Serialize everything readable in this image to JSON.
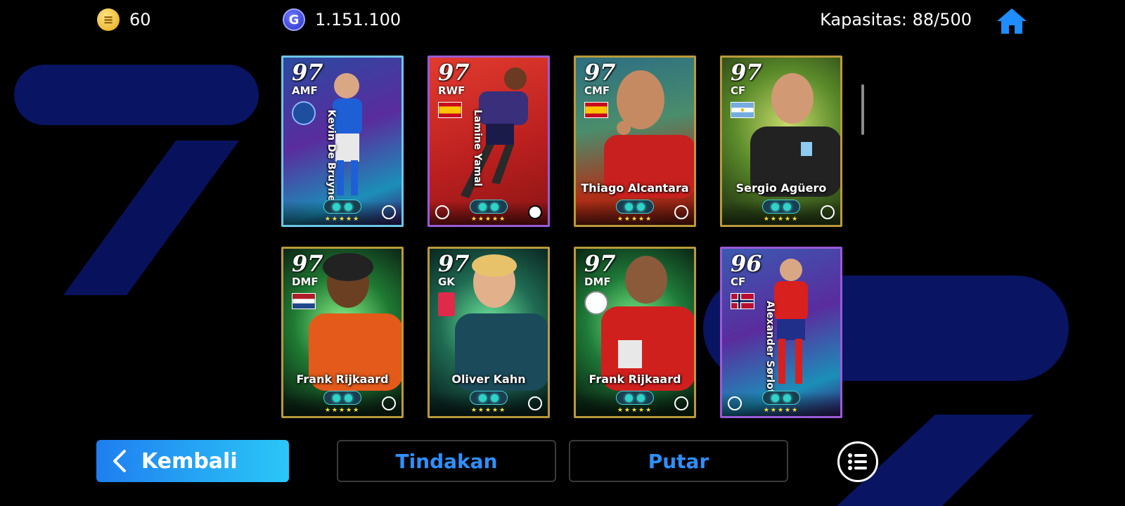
{
  "top_bar": {
    "ecoin_icon": "efootball-coin-icon",
    "ecoin_value": "60",
    "gp_icon": "gp-coin-icon",
    "gp_value": "1.151.100",
    "capacity": "Kapasitas: 88/500",
    "home_icon": "home-icon"
  },
  "cards": [
    {
      "rating": "97",
      "position": "AMF",
      "name": "Kevin De Bruyne",
      "theme": "#7b59d6"
    },
    {
      "rating": "97",
      "position": "RWF",
      "name": "Lamine Yamal",
      "theme": "#d6332e"
    },
    {
      "rating": "97",
      "position": "CMF",
      "name": "Thiago Alcantara",
      "theme": "#b89a3b"
    },
    {
      "rating": "97",
      "position": "CF",
      "name": "Sergio Agüero",
      "theme": "#b89a3b"
    },
    {
      "rating": "97",
      "position": "DMF",
      "name": "Frank Rijkaard",
      "theme": "#b89a3b"
    },
    {
      "rating": "97",
      "position": "GK",
      "name": "Oliver Kahn",
      "theme": "#b89a3b"
    },
    {
      "rating": "97",
      "position": "DMF",
      "name": "Frank Rijkaard",
      "theme": "#b89a3b"
    },
    {
      "rating": "96",
      "position": "CF",
      "name": "Alexander Sørloth",
      "theme": "#7b59d6"
    }
  ],
  "buttons": {
    "back": "Kembali",
    "actions": "Tindakan",
    "rotate": "Putar",
    "menu_icon": "list-menu-icon"
  },
  "colors": {
    "accent_blue": "#2f8fff",
    "gold_frame": "#b89a3b",
    "purple_frame": "#7b59d6"
  }
}
